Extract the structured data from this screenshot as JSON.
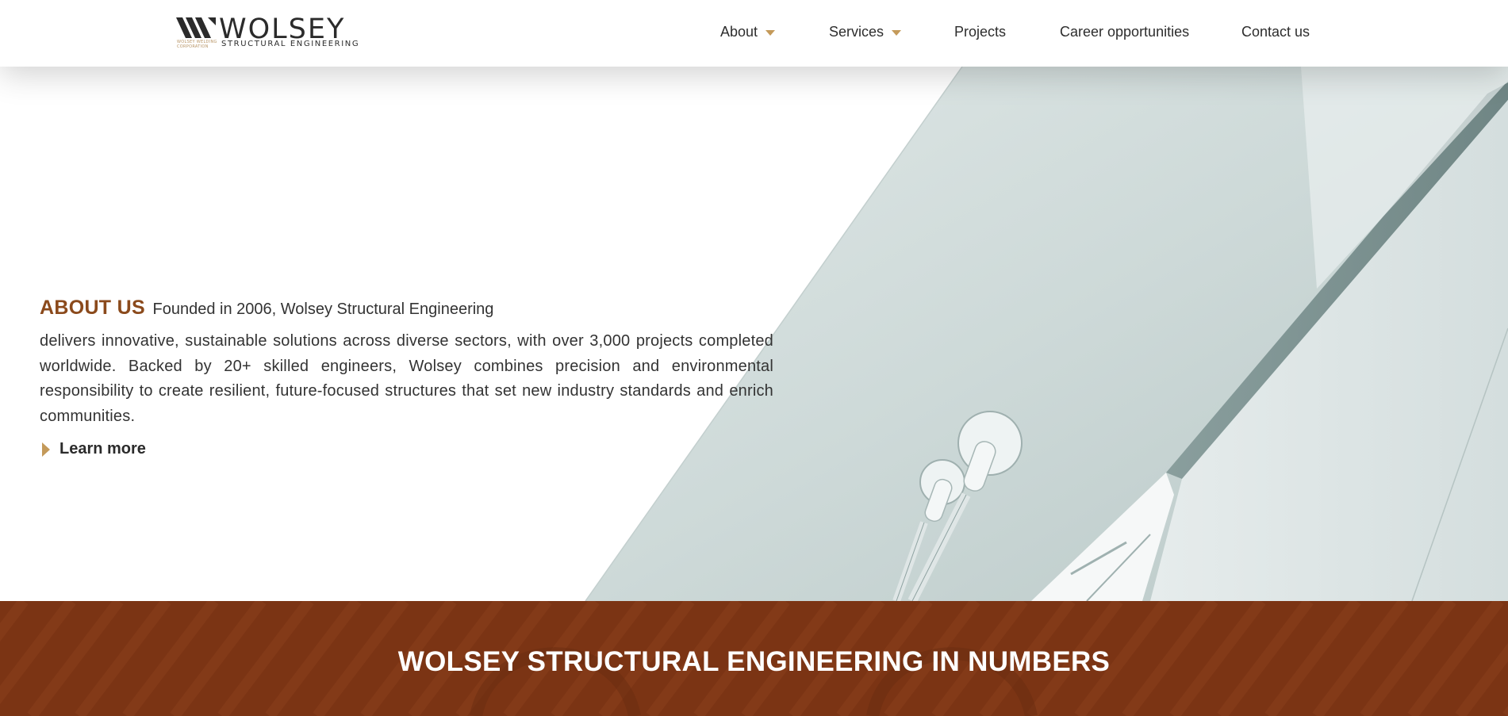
{
  "header": {
    "logo": {
      "wordmark": "WOLSEY",
      "subtitle": "STRUCTURAL ENGINEERING",
      "corp_line": "WOLSEY WELDING CORPORATION",
      "icon": "wolsey-logo-mark"
    },
    "nav": [
      {
        "label": "About",
        "has_dropdown": true
      },
      {
        "label": "Services",
        "has_dropdown": true
      },
      {
        "label": "Projects",
        "has_dropdown": false
      },
      {
        "label": "Career opportunities",
        "has_dropdown": false
      },
      {
        "label": "Contact us",
        "has_dropdown": false
      }
    ],
    "dropdown_icon": "caret-down-icon"
  },
  "about": {
    "title": "ABOUT US",
    "lead": "Founded in 2006, Wolsey Structural Engineering",
    "body": "delivers innovative, sustainable solutions across diverse sectors, with over 3,000 projects completed worldwide. Backed by 20+ skilled engineers, Wolsey combines precision and environmental responsibility to create resilient, future-focused structures that set new industry standards and enrich communities.",
    "link_label": "Learn more",
    "link_icon": "triangle-right-icon"
  },
  "numbers": {
    "title": "WOLSEY STRUCTURAL ENGINEERING IN NUMBERS"
  },
  "colors": {
    "brand_brown": "#8b4a1c",
    "band_brown": "#7b3414",
    "accent_gold": "#c49a5a",
    "text_dark": "#333333",
    "photo_tint": "#c9d6d5"
  }
}
